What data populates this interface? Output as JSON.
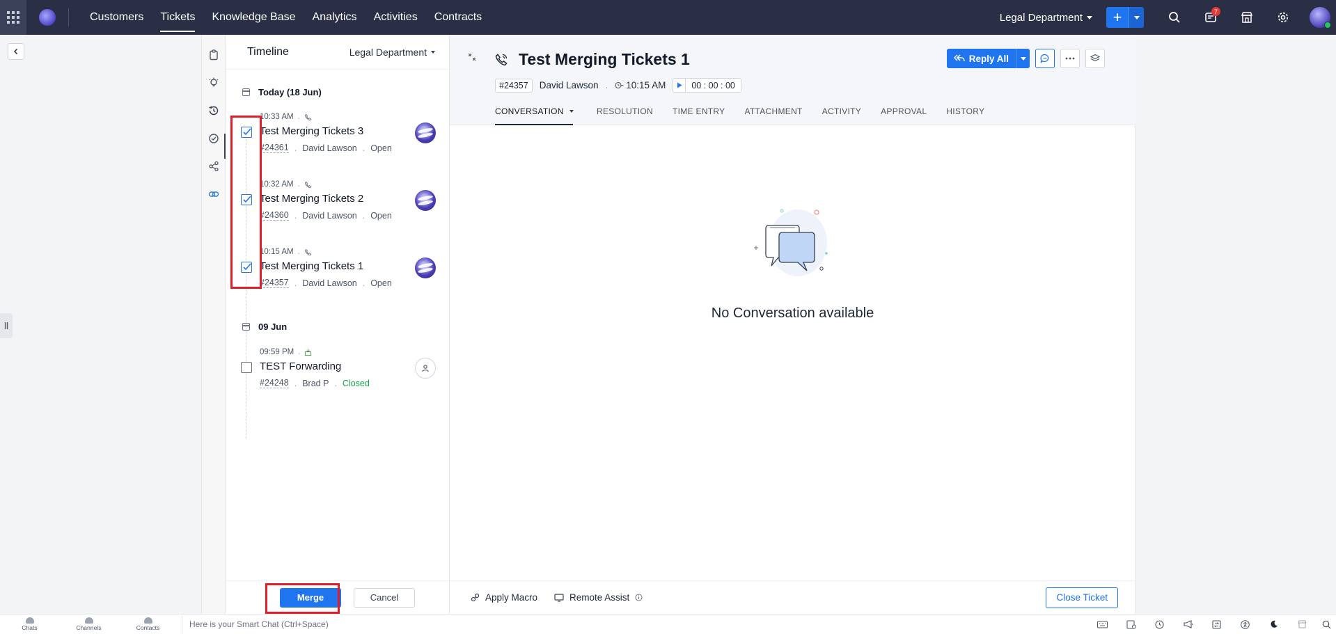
{
  "nav": {
    "items": [
      {
        "label": "Customers"
      },
      {
        "label": "Tickets"
      },
      {
        "label": "Knowledge Base"
      },
      {
        "label": "Analytics"
      },
      {
        "label": "Activities"
      },
      {
        "label": "Contracts"
      }
    ],
    "department": "Legal Department",
    "notification_count": "7",
    "accent_color": "#1f74f0"
  },
  "timeline": {
    "title": "Timeline",
    "department": "Legal Department",
    "groups": [
      {
        "date": "Today (18 Jun)"
      },
      {
        "date": "09 Jun"
      }
    ],
    "entries": [
      {
        "time": "10:33 AM",
        "subject": "Test Merging Tickets 3",
        "number": "#24361",
        "contact": "David Lawson",
        "status": "Open"
      },
      {
        "time": "10:32 AM",
        "subject": "Test Merging Tickets 2",
        "number": "#24360",
        "contact": "David Lawson",
        "status": "Open"
      },
      {
        "time": "10:15 AM",
        "subject": "Test Merging Tickets 1",
        "number": "#24357",
        "contact": "David Lawson",
        "status": "Open"
      },
      {
        "time": "09:59 PM",
        "subject": "TEST Forwarding",
        "number": "#24248",
        "contact": "Brad P",
        "status": "Closed"
      }
    ],
    "merge_label": "Merge",
    "cancel_label": "Cancel"
  },
  "ticket": {
    "title": "Test Merging Tickets 1",
    "number": "#24357",
    "contact": "David Lawson",
    "time": "10:15 AM",
    "timer": "00 : 00 : 00",
    "reply_label": "Reply All",
    "tabs": [
      {
        "label": "CONVERSATION"
      },
      {
        "label": "RESOLUTION"
      },
      {
        "label": "TIME ENTRY"
      },
      {
        "label": "ATTACHMENT"
      },
      {
        "label": "ACTIVITY"
      },
      {
        "label": "APPROVAL"
      },
      {
        "label": "HISTORY"
      }
    ],
    "empty_message": "No Conversation available",
    "footer": {
      "apply_macro": "Apply Macro",
      "remote_assist": "Remote Assist",
      "close_ticket": "Close Ticket"
    }
  },
  "bottombar": {
    "items": [
      {
        "label": "Chats"
      },
      {
        "label": "Channels"
      },
      {
        "label": "Contacts"
      }
    ],
    "smart_chat_placeholder": "Here is your Smart Chat (Ctrl+Space)"
  }
}
